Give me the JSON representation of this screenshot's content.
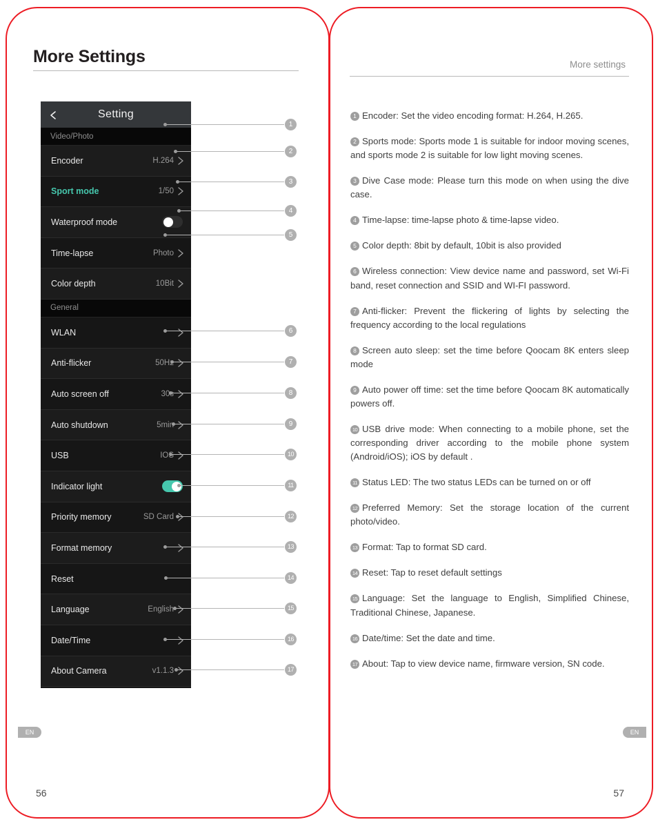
{
  "left_page": {
    "title": "More Settings",
    "folio": "56",
    "lang_tab": "EN",
    "device_ui": {
      "header": {
        "title": "Setting",
        "back_icon": "chevron-left-icon"
      },
      "sections": [
        {
          "section_label": "Video/Photo",
          "rows": [
            {
              "label": "Encoder",
              "value": "H.264",
              "control": "chevron"
            },
            {
              "label": "Sport mode",
              "value": "1/50",
              "control": "chevron",
              "highlight": true
            },
            {
              "label": "Waterproof mode",
              "value": "",
              "control": "toggle-off"
            },
            {
              "label": "Time-lapse",
              "value": "Photo",
              "control": "chevron"
            },
            {
              "label": "Color depth",
              "value": "10Bit",
              "control": "chevron"
            }
          ]
        },
        {
          "section_label": "General",
          "rows": [
            {
              "label": "WLAN",
              "value": "",
              "control": "chevron"
            },
            {
              "label": "Anti-flicker",
              "value": "50Hz",
              "control": "chevron"
            },
            {
              "label": "Auto screen off",
              "value": "30s",
              "control": "chevron"
            },
            {
              "label": "Auto shutdown",
              "value": "5min",
              "control": "chevron"
            },
            {
              "label": "USB",
              "value": "IOS",
              "control": "chevron"
            },
            {
              "label": "Indicator light",
              "value": "",
              "control": "toggle-on"
            },
            {
              "label": "Priority memory",
              "value": "SD Card",
              "control": "chevron"
            },
            {
              "label": "Format memory",
              "value": "",
              "control": "chevron"
            },
            {
              "label": "Reset",
              "value": "",
              "control": "none"
            },
            {
              "label": "Language",
              "value": "English",
              "control": "chevron"
            },
            {
              "label": "Date/Time",
              "value": "",
              "control": "chevron"
            },
            {
              "label": "About Camera",
              "value": "v1.1.3",
              "control": "chevron"
            }
          ]
        }
      ]
    },
    "callout_numbers": [
      "1",
      "2",
      "3",
      "4",
      "5",
      "6",
      "7",
      "8",
      "9",
      "10",
      "11",
      "12",
      "13",
      "14",
      "15",
      "16",
      "17"
    ]
  },
  "right_page": {
    "eyebrow": "More settings",
    "folio": "57",
    "lang_tab": "EN",
    "notes": [
      {
        "num": "1",
        "text": "Encoder: Set the video encoding format: H.264, H.265."
      },
      {
        "num": "2",
        "text": "Sports mode: Sports mode 1 is suitable for indoor moving scenes, and sports mode 2 is suitable for low light moving scenes."
      },
      {
        "num": "3",
        "text": "Dive Case mode: Please turn this mode on when using the dive case."
      },
      {
        "num": "4",
        "text": "Time-lapse: time-lapse photo & time-lapse video."
      },
      {
        "num": "5",
        "text": "Color depth: 8bit by default, 10bit is also provided"
      },
      {
        "num": "6",
        "text": "Wireless connection: View device name and password, set Wi-Fi band, reset connection and SSID and WI-FI password."
      },
      {
        "num": "7",
        "text": "Anti-flicker: Prevent the flickering of lights by selecting the frequency according to the local regulations"
      },
      {
        "num": "8",
        "text": "Screen auto sleep: set the time before Qoocam 8K enters sleep mode"
      },
      {
        "num": "9",
        "text": "Auto power off time: set the time before Qoocam 8K automatically powers off."
      },
      {
        "num": "10",
        "text": "USB drive mode: When connecting to a mobile phone, set the corresponding driver according to the mobile phone system (Android/iOS); iOS by default ."
      },
      {
        "num": "11",
        "text": "Status LED: The two status LEDs can be turned on or off"
      },
      {
        "num": "12",
        "text": "Preferred Memory: Set the storage location of the current photo/video."
      },
      {
        "num": "13",
        "text": "Format: Tap to format SD card."
      },
      {
        "num": "14",
        "text": "Reset: Tap to reset default settings"
      },
      {
        "num": "15",
        "text": "Language: Set the language to English, Simplified Chinese, Traditional Chinese, Japanese."
      },
      {
        "num": "16",
        "text": "Date/time: Set the date and time."
      },
      {
        "num": "17",
        "text": "About: Tap to view device name, firmware version, SN code."
      }
    ]
  },
  "colors": {
    "frame_red": "#ed1c24",
    "accent_teal": "#46c7ad",
    "panel_bg": "#1c1c1c",
    "callout_gray": "#b0b0b0"
  }
}
